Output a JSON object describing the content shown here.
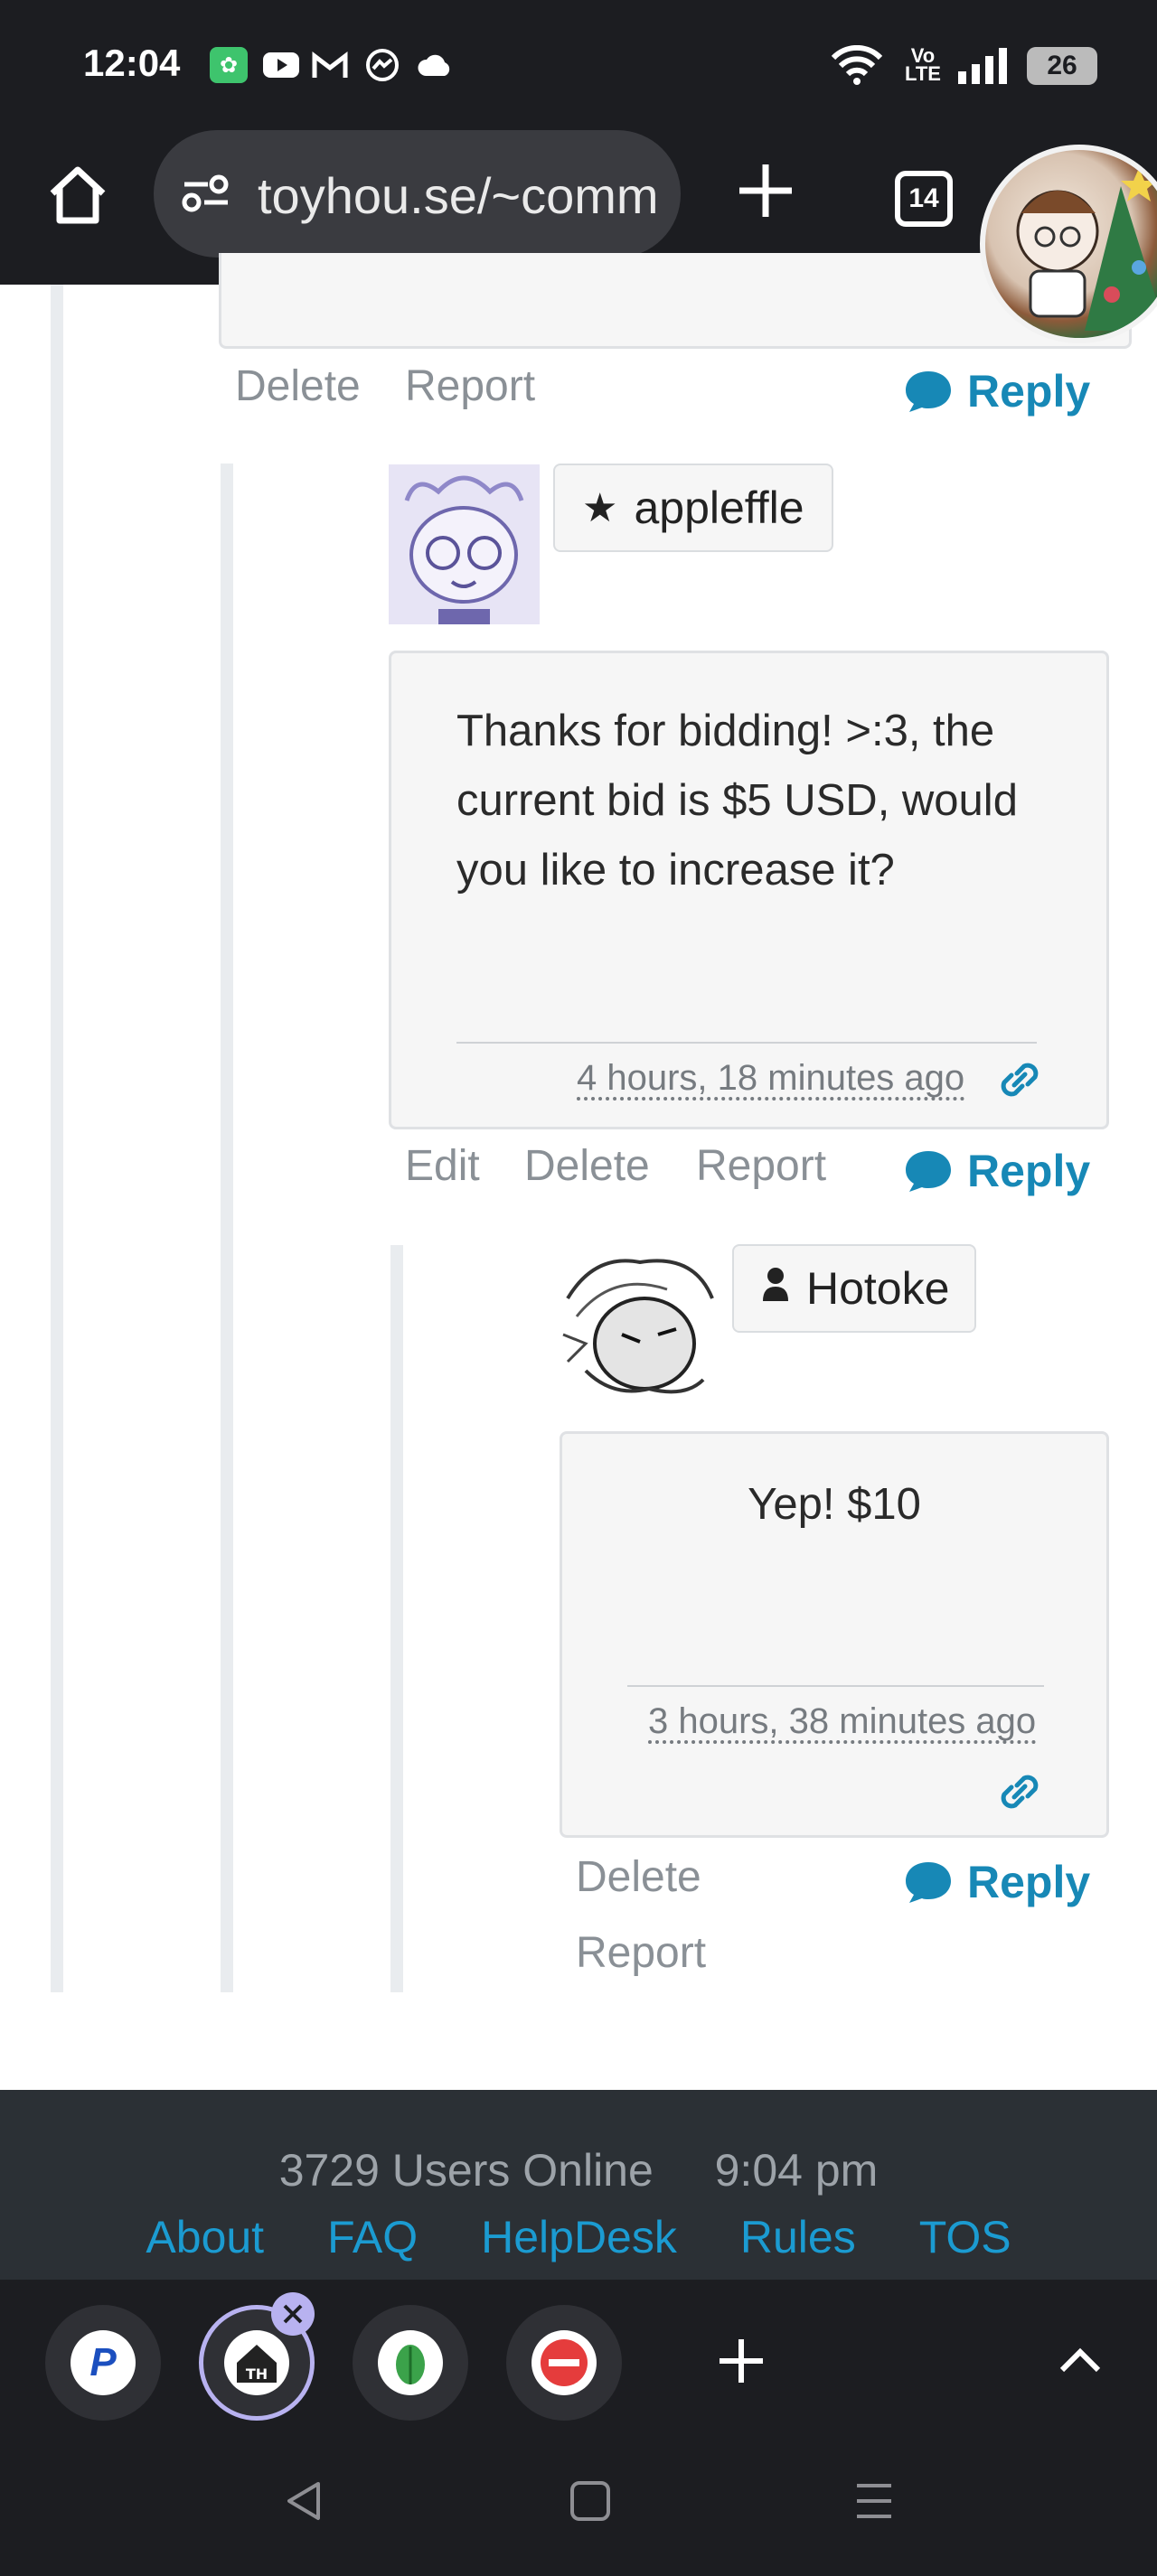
{
  "status_bar": {
    "time": "12:04",
    "battery": "26",
    "network": "Vo LTE"
  },
  "browser": {
    "url": "toyhou.se/~comm",
    "tab_count": "14"
  },
  "thread": {
    "top_actions": {
      "delete": "Delete",
      "report": "Report",
      "reply": "Reply"
    },
    "comment_1": {
      "username": "appleffle",
      "user_icon": "star-icon",
      "text": "Thanks for bidding! >:3, the current bid is $5 USD, would you like to increase it?",
      "timestamp": "4 hours, 18 minutes ago",
      "actions": {
        "edit": "Edit",
        "delete": "Delete",
        "report": "Report",
        "reply": "Reply"
      }
    },
    "comment_2": {
      "username": "Hotoke",
      "user_icon": "user-icon",
      "text": "Yep! $10",
      "timestamp": "3 hours, 38 minutes ago",
      "actions": {
        "delete": "Delete",
        "report": "Report",
        "reply": "Reply"
      }
    }
  },
  "footer": {
    "users_online": "3729 Users Online",
    "time": "9:04 pm",
    "links": [
      "About",
      "FAQ",
      "HelpDesk",
      "Rules",
      "TOS"
    ]
  },
  "colors": {
    "accent": "#1788b6",
    "link": "#1b9bd1",
    "footer_bg": "#2b3035",
    "chrome_bg": "#1c1d21"
  }
}
